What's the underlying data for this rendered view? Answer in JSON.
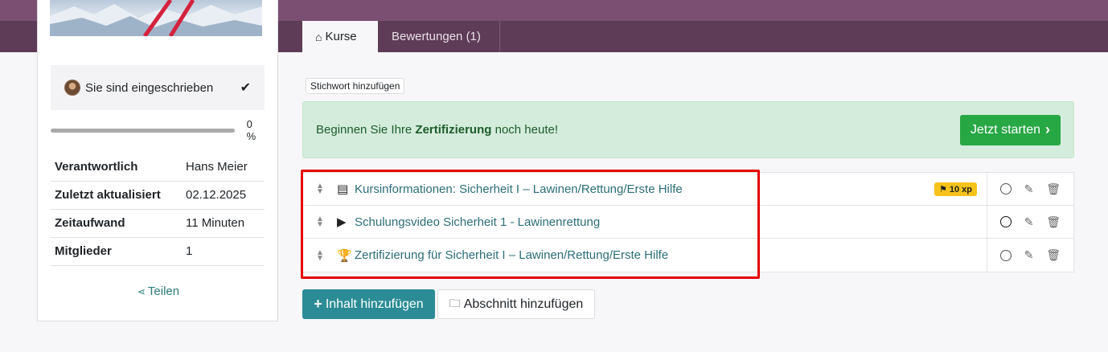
{
  "tabs": [
    {
      "label": "Kurse",
      "icon": "home-icon"
    },
    {
      "label": "Bewertungen (1)"
    }
  ],
  "sidebar": {
    "enrolled_text": "Sie sind eingeschrieben",
    "progress_percent": 0,
    "progress_label": "0 %",
    "info": [
      {
        "key": "Verantwortlich",
        "value": "Hans Meier"
      },
      {
        "key": "Zuletzt aktualisiert",
        "value": "02.12.2025"
      },
      {
        "key": "Zeitaufwand",
        "value": "11 Minuten"
      },
      {
        "key": "Mitglieder",
        "value": "1"
      }
    ],
    "share_label": "Teilen"
  },
  "tag_button": "Stichwort hinzufügen",
  "banner": {
    "text_before": "Beginnen Sie Ihre ",
    "text_bold": "Zertifizierung",
    "text_after": " noch heute!",
    "button_label": "Jetzt starten"
  },
  "content": [
    {
      "title": "Kursinformationen: Sicherheit I – Lawinen/Rettung/Erste Hilfe",
      "icon": "document-icon",
      "xp": "10 xp"
    },
    {
      "title": "Schulungsvideo Sicherheit 1 - Lawinenrettung",
      "icon": "youtube-icon"
    },
    {
      "title": "Zertifizierung für Sicherheit I – Lawinen/Rettung/Erste Hilfe",
      "icon": "trophy-icon"
    }
  ],
  "buttons": {
    "add_content": "Inhalt hinzufügen",
    "add_section": "Abschnitt hinzufügen"
  },
  "colors": {
    "header": "#5e3c57",
    "banner_bg": "#d4ecdc",
    "start_button": "#28a745",
    "add_button": "#2b8c96",
    "highlight": "#e60000"
  }
}
